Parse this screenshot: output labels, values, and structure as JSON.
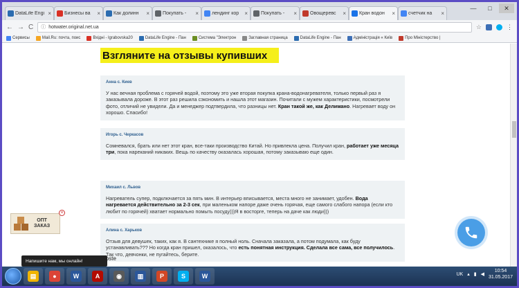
{
  "tabs": [
    {
      "label": "DataLife Engi",
      "color": "#2b6cb0"
    },
    {
      "label": "Бизнесы ва",
      "color": "#d93025"
    },
    {
      "label": "Как долинн",
      "color": "#2b6cb0"
    },
    {
      "label": "Покупать -",
      "color": "#5f6368"
    },
    {
      "label": "лендинг кор",
      "color": "#4285f4"
    },
    {
      "label": "Покупать -",
      "color": "#5f6368"
    },
    {
      "label": "Овощеревс",
      "color": "#c0392b"
    },
    {
      "label": "Кран водон",
      "color": "#1a73e8",
      "active": true
    },
    {
      "label": "счетчик на",
      "color": "#4285f4"
    }
  ],
  "window": {
    "minimize": "—",
    "maximize": "□",
    "close": "✕"
  },
  "address": {
    "url": "hotwater.original.net.ua",
    "back": "←",
    "forward": "→",
    "reload": "C"
  },
  "bookmarks": [
    {
      "label": "Сервисы",
      "color": "#4285f4"
    },
    {
      "label": "Mail.Ru: почта, поис",
      "color": "#f5a623"
    },
    {
      "label": "Вхідні - lgrabovska20",
      "color": "#d93025"
    },
    {
      "label": "DataLife Engine - Пан",
      "color": "#2b6cb0"
    },
    {
      "label": "Система \"Электрон",
      "color": "#6b8e23"
    },
    {
      "label": "Заглавная страница",
      "color": "#888"
    },
    {
      "label": "DataLife Engine - Пан",
      "color": "#2b6cb0"
    },
    {
      "label": "Адміністрація « Київ",
      "color": "#3d6fb6"
    },
    {
      "label": "Про Міністерство |",
      "color": "#c0392b"
    }
  ],
  "page": {
    "heading": "Взгляните на отзывы купивших",
    "reviews": [
      {
        "author": "Анна с. Киев",
        "parts": [
          {
            "t": "У нас вечная проблема с горячей водой, поэтому это уже вторая покупка крана-водонагревателя, только первый раз я заказывала дороже. В этот раз решила сэкономить и нашла этот магазин. Почитали с мужем характеристики, посмотрели фото, отличий не увидели. Да и менеджер подтвердила, что разницы нет. ",
            "b": false
          },
          {
            "t": "Кран такой же, как Делимано",
            "b": true
          },
          {
            "t": ". Нагревает воду он хорошо. Спасибо!",
            "b": false
          }
        ]
      },
      {
        "author": "Игорь с. Черкасов",
        "parts": [
          {
            "t": "Сомневался, брать или нет этот кран, все-таки производство Китай. Но привлекла цена. Получил кран, ",
            "b": false
          },
          {
            "t": "работает уже месяца три",
            "b": true
          },
          {
            "t": ", пока нареканий никаких. Вещь по качеству оказалась хорошая, потому заказываю еще один.",
            "b": false
          }
        ]
      },
      {
        "author": "Михаил с. Львов",
        "parts": [
          {
            "t": "Нагреватель супер, подключается за пять мин. В интерьер вписывается, места много не занимает, удобен. ",
            "b": false
          },
          {
            "t": "Вода нагревается действительно за 2-3 сек",
            "b": true
          },
          {
            "t": ", при маленьком напоре даже очень горячая, еще самого слабого напора (если кто любит по горячей) хватает нормально помыть посуду)))Я в восторге, теперь на даче как люди)))",
            "b": false
          }
        ]
      },
      {
        "author": "Алина с. Харьков",
        "parts": [
          {
            "t": "Отзыв для девушек, таких, как я. В сантехнике я полный ноль. Сначала заказала, а потом подумала, как буду устанавливать??? Но когда кран пришел, оказалось, что ",
            "b": false
          },
          {
            "t": "есть понятная инструкция. Сделала все сама, все получилось",
            "b": true
          },
          {
            "t": ". Так что, девчонки, не пугайтесь, берите.",
            "b": false
          }
        ]
      }
    ],
    "opt": {
      "line1": "ОПТ",
      "line2": "ЗАКАЗ"
    },
    "chat": "Напишите нам, мы онлайн!",
    "vk_partial": "jvoste"
  },
  "taskbar": {
    "apps": [
      {
        "name": "file-explorer",
        "glyph": "▤",
        "color": "#f0b400"
      },
      {
        "name": "chrome",
        "glyph": "●",
        "color": "#db4437"
      },
      {
        "name": "word",
        "glyph": "W",
        "color": "#2b579a"
      },
      {
        "name": "acrobat",
        "glyph": "A",
        "color": "#b30b00"
      },
      {
        "name": "media",
        "glyph": "◉",
        "color": "#5a5a5a"
      },
      {
        "name": "document",
        "glyph": "▥",
        "color": "#2b579a"
      },
      {
        "name": "powerpoint",
        "glyph": "P",
        "color": "#d24726"
      },
      {
        "name": "skype",
        "glyph": "S",
        "color": "#00aff0"
      },
      {
        "name": "word-2",
        "glyph": "W",
        "color": "#2b579a"
      }
    ],
    "lang": "UK",
    "time": "10:54",
    "date": "31.05.2017"
  }
}
